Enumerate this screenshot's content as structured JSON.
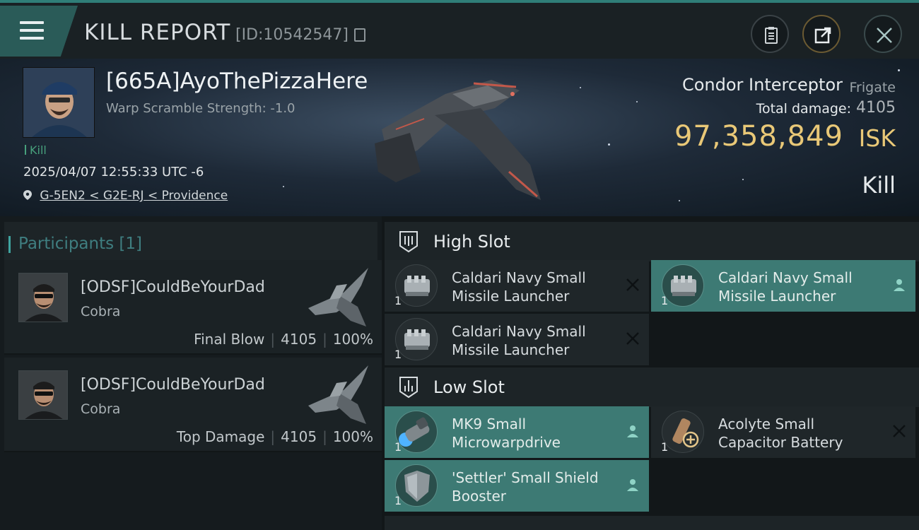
{
  "header": {
    "title": "KILL REPORT",
    "report_id": "[ID:10542547]"
  },
  "victim": {
    "name": "[665A]AyoThePizzaHere",
    "warp_scramble": "Warp Scramble Strength: -1.0",
    "kill_tag": "Kill",
    "datetime": "2025/04/07 12:55:33 UTC -6",
    "location": "G-5EN2 < G2E-RJ < Providence",
    "ship_name": "Condor Interceptor",
    "ship_class": "Frigate",
    "total_damage_label": "Total damage:",
    "total_damage": "4105",
    "isk_value": "97,358,849",
    "isk_unit": "ISK",
    "result": "Kill"
  },
  "participants": {
    "header": "Participants [1]",
    "rows": [
      {
        "name": "[ODSF]CouldBeYourDad",
        "ship": "Cobra",
        "role": "Final Blow",
        "damage": "4105",
        "percent": "100%"
      },
      {
        "name": "[ODSF]CouldBeYourDad",
        "ship": "Cobra",
        "role": "Top Damage",
        "damage": "4105",
        "percent": "100%"
      }
    ]
  },
  "fitting": {
    "high_slot": {
      "title": "High Slot",
      "modules": [
        {
          "qty": "1",
          "name": "Caldari Navy Small Missile Launcher",
          "status": "destroyed"
        },
        {
          "qty": "1",
          "name": "Caldari Navy Small Missile Launcher",
          "status": "dropped"
        },
        {
          "qty": "1",
          "name": "Caldari Navy Small Missile Launcher",
          "status": "destroyed"
        }
      ]
    },
    "low_slot": {
      "title": "Low Slot",
      "modules": [
        {
          "qty": "1",
          "name": "MK9 Small Microwarpdrive",
          "status": "dropped"
        },
        {
          "qty": "1",
          "name": "Acolyte Small Capacitor Battery",
          "status": "destroyed"
        },
        {
          "qty": "1",
          "name": "'Settler' Small Shield Booster",
          "status": "dropped"
        }
      ]
    }
  },
  "colors": {
    "accent_teal": "#3d7a74",
    "isk_gold": "#e9c877",
    "kill_green": "#47a07c"
  },
  "icons": [
    "menu-icon",
    "copy-icon",
    "clipboard-icon",
    "share-icon",
    "close-icon",
    "location-pin-icon",
    "high-slot-icon",
    "low-slot-icon",
    "destroyed-x-icon",
    "dropped-person-icon"
  ]
}
